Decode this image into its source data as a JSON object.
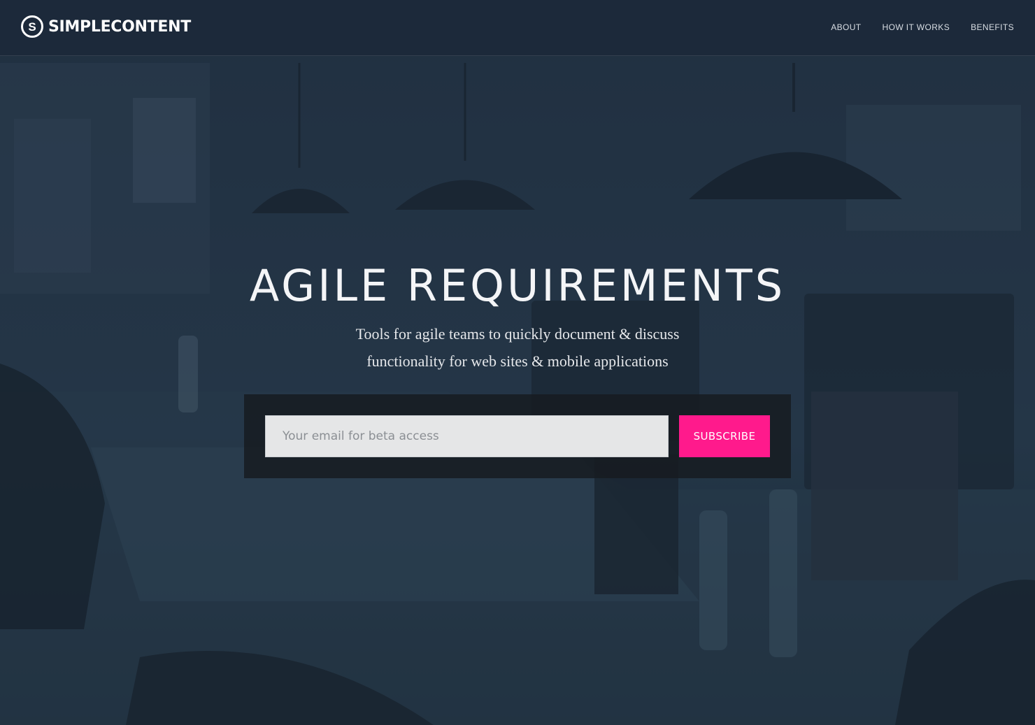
{
  "brand": {
    "logo_mark": "S",
    "name": "SIMPLECONTENT"
  },
  "nav": {
    "items": [
      {
        "label": "ABOUT"
      },
      {
        "label": "HOW IT WORKS"
      },
      {
        "label": "BENEFITS"
      }
    ]
  },
  "hero": {
    "title": "AGILE REQUIREMENTS",
    "subtitle_line1": "Tools for agile teams to quickly document & discuss",
    "subtitle_line2": "functionality for web sites & mobile applications"
  },
  "subscribe": {
    "placeholder": "Your email for beta access",
    "value": "",
    "button_label": "SUBSCRIBE"
  },
  "colors": {
    "accent": "#ff1a8c",
    "header_bg": "#1a2738",
    "hero_bg": "#26384a",
    "input_bg": "#e5e6e7"
  },
  "background": {
    "description_icon": "office-photo-background"
  }
}
